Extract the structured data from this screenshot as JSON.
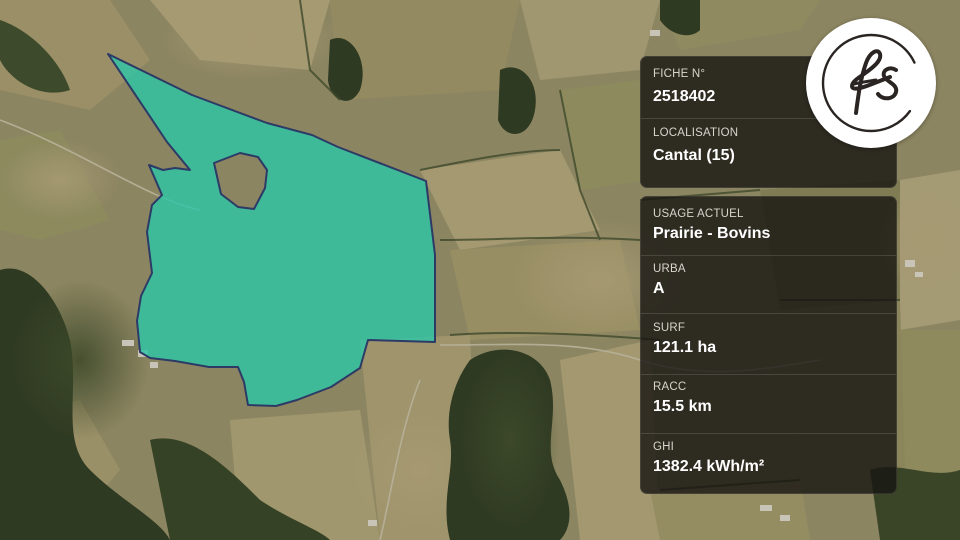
{
  "map": {
    "parcel_color": "#2ec6a6",
    "parcel_stroke": "#2d3a66"
  },
  "brand": {
    "logo_text": "fs"
  },
  "sheet": {
    "fiche_label": "FICHE N°",
    "fiche_value": "2518402",
    "localisation_label": "LOCALISATION",
    "localisation_value": "Cantal (15)"
  },
  "details": {
    "usage_label": "USAGE ACTUEL",
    "usage_value": "Prairie - Bovins",
    "urba_label": "URBA",
    "urba_value": "A",
    "surf_label": "SURF",
    "surf_value": "121.1 ha",
    "racc_label": "RACC",
    "racc_value": "15.5 km",
    "ghi_label": "GHI",
    "ghi_value": "1382.4 kWh/m²"
  }
}
